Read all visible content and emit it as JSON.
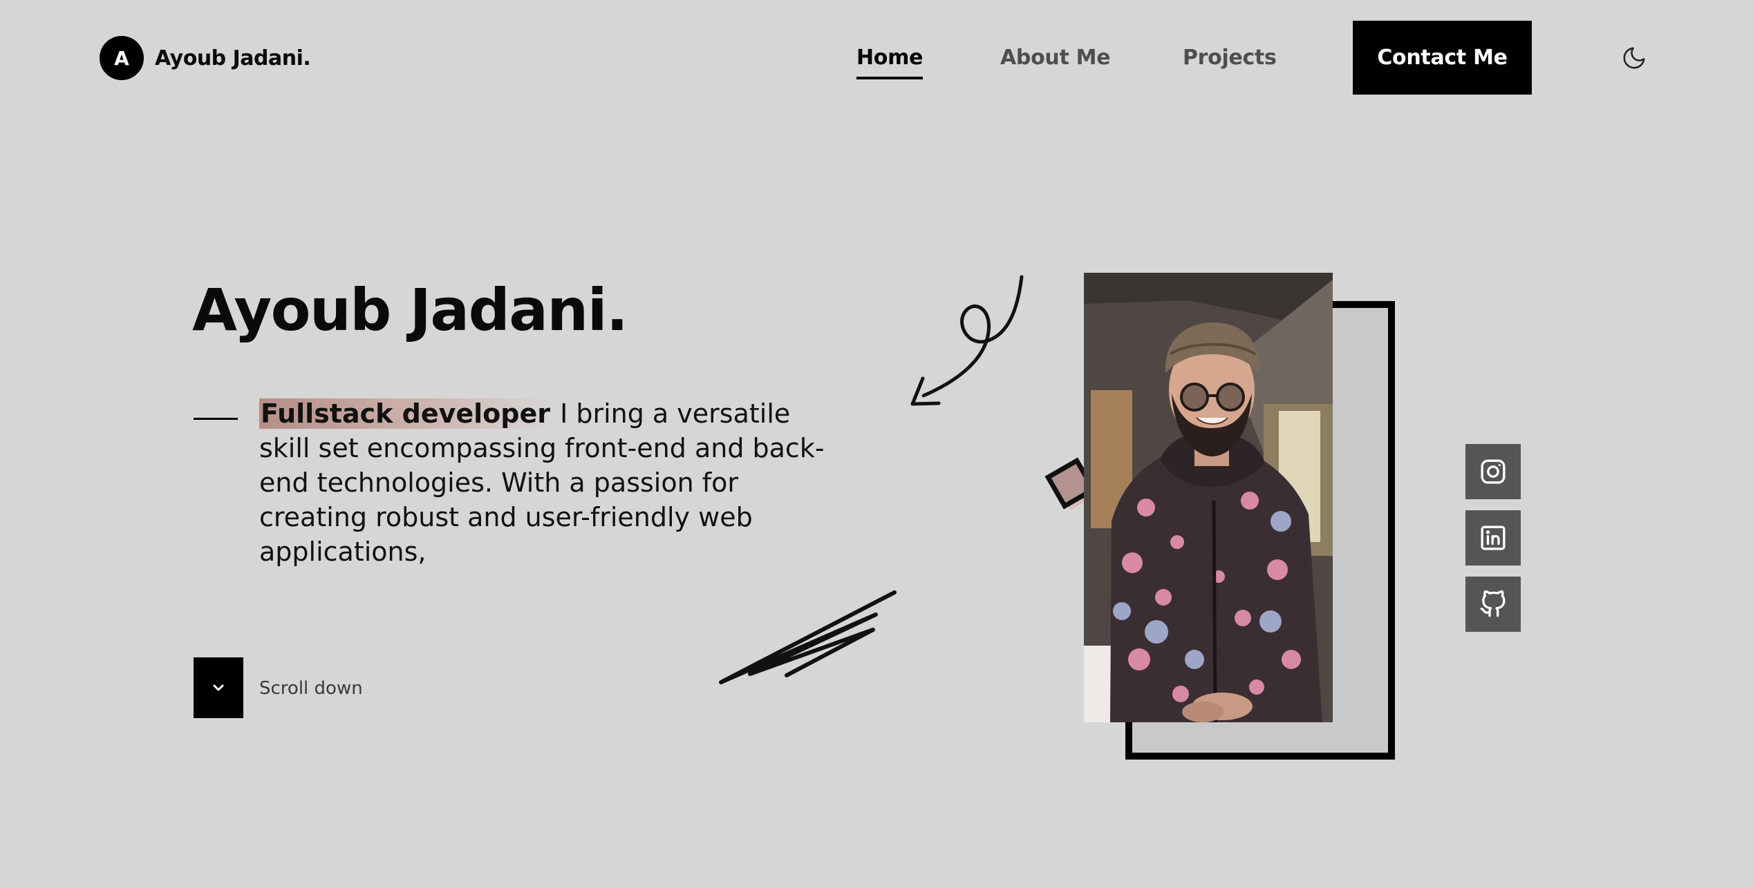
{
  "brand": {
    "initial": "A",
    "name": "Ayoub Jadani."
  },
  "nav": {
    "items": [
      {
        "label": "Home",
        "active": true
      },
      {
        "label": "About Me",
        "active": false
      },
      {
        "label": "Projects",
        "active": false
      }
    ],
    "contact_label": "Contact Me",
    "theme_icon": "moon-icon"
  },
  "hero": {
    "title": "Ayoub Jadani.",
    "role": "Fullstack developer",
    "description": " I bring a versatile skill set encompassing front-end and back-end technologies. With a passion for creating robust and user-friendly web applications,",
    "scroll_label": "Scroll down"
  },
  "socials": [
    {
      "name": "instagram",
      "icon": "instagram-icon"
    },
    {
      "name": "linkedin",
      "icon": "linkedin-icon"
    },
    {
      "name": "github",
      "icon": "github-icon"
    }
  ],
  "colors": {
    "background": "#d6d6d6",
    "accent": "#000000",
    "highlight": "#b58e86",
    "social_bg": "#555555"
  }
}
